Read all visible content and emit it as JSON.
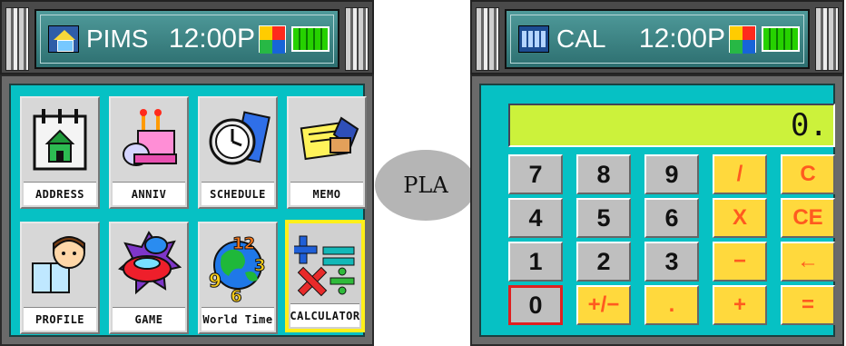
{
  "pims": {
    "status_bar": {
      "app_title": "PIMS",
      "clock": "12:00P"
    },
    "menu": [
      {
        "label": "ADDRESS",
        "icon": "address-book-icon"
      },
      {
        "label": "ANNIV",
        "icon": "anniversary-cake-icon"
      },
      {
        "label": "SCHEDULE",
        "icon": "schedule-clock-icon"
      },
      {
        "label": "MEMO",
        "icon": "memo-notes-icon"
      },
      {
        "label": "PROFILE",
        "icon": "profile-person-icon"
      },
      {
        "label": "GAME",
        "icon": "game-car-icon"
      },
      {
        "label": "World Time",
        "icon": "world-time-globe-icon"
      },
      {
        "label": "CALCULATOR",
        "icon": "calculator-icon"
      }
    ],
    "selected_item": "CALCULATOR"
  },
  "transition_bubble": {
    "label": "PLA"
  },
  "calculator": {
    "status_bar": {
      "app_title": "CAL",
      "clock": "12:00P"
    },
    "display_value": "0.",
    "keys": [
      [
        "7",
        "8",
        "9",
        "/",
        "C"
      ],
      [
        "4",
        "5",
        "6",
        "X",
        "CE"
      ],
      [
        "1",
        "2",
        "3",
        "−",
        "←"
      ],
      [
        "0",
        "+/−",
        ".",
        "+",
        "="
      ]
    ],
    "selected_key": "0"
  },
  "colors": {
    "screen_bg": "#06c1c4",
    "display_bg": "#ccf23b",
    "number_key": "#bfbfbf",
    "operator_key": "#ffd93d",
    "operator_text": "#ff5a1f",
    "selection_highlight": "#ffef1a"
  }
}
